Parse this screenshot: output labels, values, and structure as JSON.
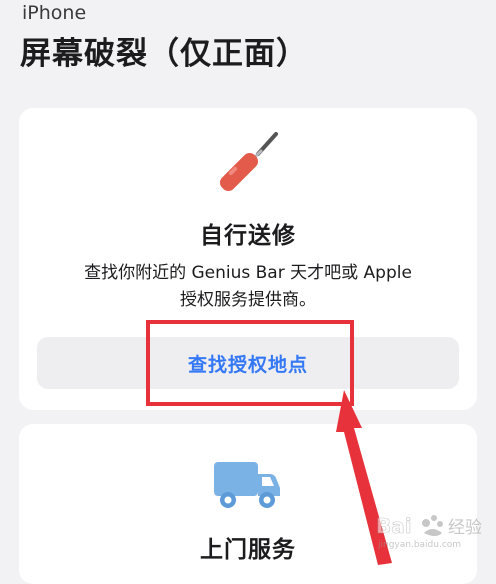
{
  "header": {
    "eyebrow": "iPhone",
    "title": "屏幕破裂（仅正面）"
  },
  "carry_in": {
    "icon": "wrench-icon",
    "heading": "自行送修",
    "description_line1": "查找你附近的 Genius Bar 天才吧或 Apple",
    "description_line2": "授权服务提供商。",
    "button_label": "查找授权地点"
  },
  "onsite": {
    "icon": "truck-icon",
    "heading": "上门服务"
  },
  "annotation": {
    "highlight_color": "#e8323b"
  },
  "colors": {
    "background": "#f2f2f4",
    "card": "#ffffff",
    "link_blue": "#3478f6",
    "wrench_red": "#e25b4b",
    "truck_blue": "#7ab2e6"
  }
}
